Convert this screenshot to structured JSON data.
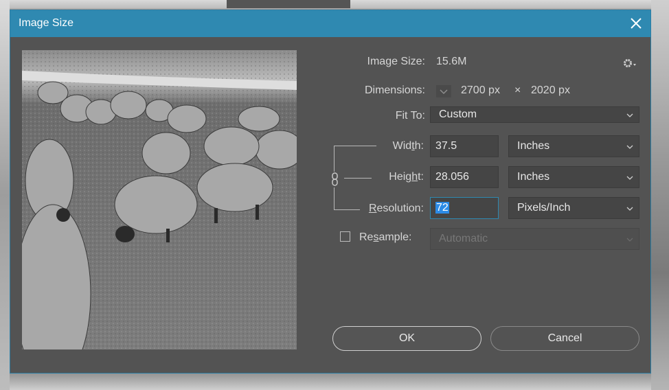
{
  "window": {
    "title": "Image Size"
  },
  "info": {
    "image_size_label": "Image Size:",
    "image_size_value": "15.6M",
    "dimensions_label": "Dimensions:",
    "dimensions_width": "2700 px",
    "dimensions_sep": "×",
    "dimensions_height": "2020 px"
  },
  "fit_to": {
    "label": "Fit To:",
    "value": "Custom"
  },
  "width": {
    "label_pre": "Wid",
    "label_u": "t",
    "label_post": "h:",
    "value": "37.5",
    "unit": "Inches"
  },
  "height": {
    "label_pre": "Heig",
    "label_u": "h",
    "label_post": "t:",
    "value": "28.056",
    "unit": "Inches"
  },
  "resolution": {
    "label_u": "R",
    "label_post": "esolution:",
    "value": "72",
    "unit": "Pixels/Inch"
  },
  "resample": {
    "label_pre": "Re",
    "label_u": "s",
    "label_post": "ample:",
    "checked": false,
    "value": "Automatic"
  },
  "buttons": {
    "ok": "OK",
    "cancel": "Cancel"
  },
  "icons": {
    "close": "close-icon",
    "gear": "gear-icon",
    "chain": "chain-link-icon",
    "dimensions": "dimensions-toggle-icon",
    "caret": "chevron-down-icon"
  },
  "colors": {
    "titlebar": "#2f89b1",
    "dialog": "#535353",
    "selection": "#2c8be6"
  }
}
